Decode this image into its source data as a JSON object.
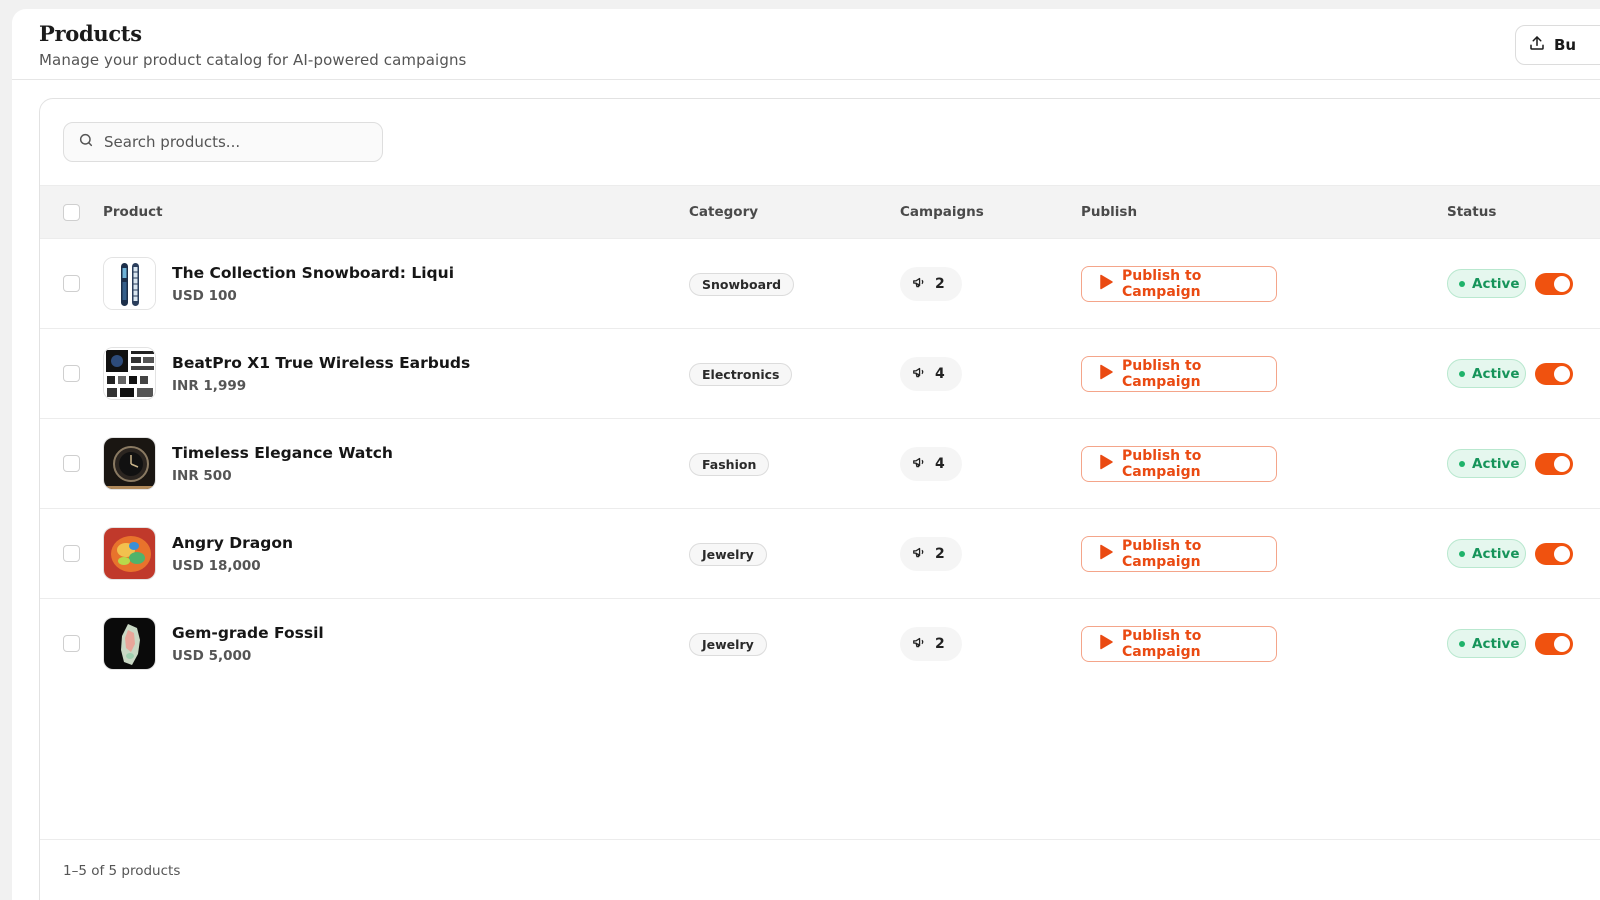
{
  "header": {
    "title": "Products",
    "subtitle": "Manage your product catalog for AI-powered campaigns",
    "bulk_label": "Bu"
  },
  "search": {
    "placeholder": "Search products..."
  },
  "table": {
    "columns": {
      "product": "Product",
      "category": "Category",
      "campaigns": "Campaigns",
      "publish": "Publish",
      "status": "Status"
    },
    "rows": [
      {
        "name": "The Collection Snowboard: Liqui",
        "price": "USD 100",
        "category": "Snowboard",
        "campaigns": "2",
        "publish_label": "Publish to Campaign",
        "status": "Active",
        "enabled": true,
        "thumb": "snowboard"
      },
      {
        "name": "BeatPro X1 True Wireless Earbuds",
        "price": "INR 1,999",
        "category": "Electronics",
        "campaigns": "4",
        "publish_label": "Publish to Campaign",
        "status": "Active",
        "enabled": true,
        "thumb": "earbuds"
      },
      {
        "name": "Timeless Elegance Watch",
        "price": "INR 500",
        "category": "Fashion",
        "campaigns": "4",
        "publish_label": "Publish to Campaign",
        "status": "Active",
        "enabled": true,
        "thumb": "watch"
      },
      {
        "name": "Angry Dragon",
        "price": "USD 18,000",
        "category": "Jewelry",
        "campaigns": "2",
        "publish_label": "Publish to Campaign",
        "status": "Active",
        "enabled": true,
        "thumb": "opal"
      },
      {
        "name": "Gem-grade Fossil",
        "price": "USD 5,000",
        "category": "Jewelry",
        "campaigns": "2",
        "publish_label": "Publish to Campaign",
        "status": "Active",
        "enabled": true,
        "thumb": "fossil"
      }
    ]
  },
  "footer": {
    "range_text": "1–5 of 5 products"
  },
  "colors": {
    "accent": "#ea4a12",
    "status_green": "#16945a",
    "toggle_on": "#f0520f"
  },
  "icons": {
    "upload": "upload-icon",
    "search": "search-icon",
    "campaign": "megaphone-icon",
    "publish": "play-icon"
  }
}
